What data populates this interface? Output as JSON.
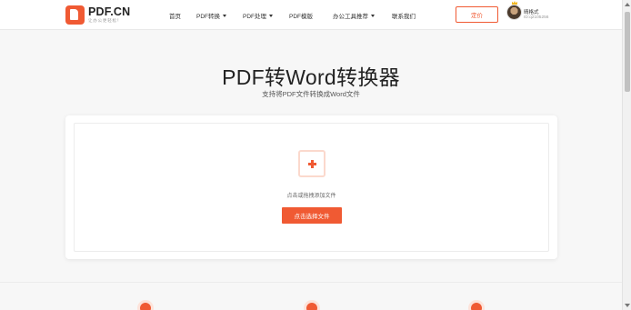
{
  "header": {
    "logo_title": "PDF.CN",
    "logo_slogan": "让办公更轻松！",
    "nav": [
      {
        "label": "首页",
        "dropdown": false
      },
      {
        "label": "PDF转换",
        "dropdown": true
      },
      {
        "label": "PDF处理",
        "dropdown": true
      },
      {
        "label": "PDF模版",
        "dropdown": false
      },
      {
        "label": "办公工具推荐",
        "dropdown": true
      },
      {
        "label": "联系我们",
        "dropdown": false
      }
    ],
    "price_button": "定价",
    "user": {
      "name": "晴格式",
      "id": "ID:q2105256"
    }
  },
  "hero": {
    "title": "PDF转Word转换器",
    "subtitle": "支持将PDF文件转换成Word文件"
  },
  "upload": {
    "hint": "点击或拖拽添加文件",
    "select_button": "点击选择文件"
  },
  "colors": {
    "accent": "#f05a33"
  }
}
